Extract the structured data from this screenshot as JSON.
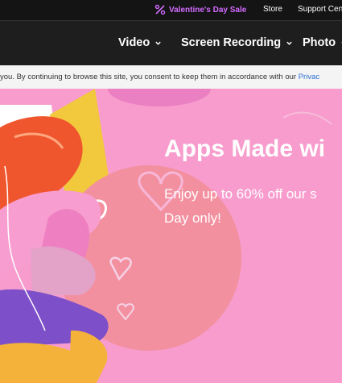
{
  "topbar": {
    "sale_icon": "percent-icon",
    "sale_label": "Valentine's Day Sale",
    "store_label": "Store",
    "support_label": "Support Cen"
  },
  "nav": {
    "items": [
      {
        "label": "Video"
      },
      {
        "label": "Screen Recording"
      },
      {
        "label": "Photo"
      }
    ]
  },
  "cookie": {
    "text": "you. By continuing to browse this site, you consent to keep them in accordance with our ",
    "link": "Privac"
  },
  "hero": {
    "title": "Apps Made wi",
    "subtitle_line1": "Enjoy up to 60% off our s",
    "subtitle_line2": "Day only!"
  },
  "colors": {
    "topbar_bg": "#141414",
    "nav_bg": "#1e1e1e",
    "sale_accent": "#d36bff",
    "hero_bg": "#f79ccd"
  }
}
